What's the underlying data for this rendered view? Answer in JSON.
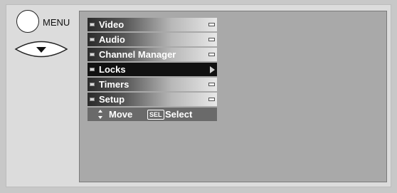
{
  "remote": {
    "menu_label": "MENU",
    "down_key_icon": "down-arrow-icon"
  },
  "osd_menu": {
    "items": [
      {
        "label": "Video",
        "selected": false
      },
      {
        "label": "Audio",
        "selected": false
      },
      {
        "label": "Channel Manager",
        "selected": false
      },
      {
        "label": "Locks",
        "selected": true
      },
      {
        "label": "Timers",
        "selected": false
      },
      {
        "label": "Setup",
        "selected": false
      }
    ],
    "help": {
      "move_icon": "up-down-arrow-icon",
      "move_label": "Move",
      "select_key_label": "SEL",
      "select_label": "Select"
    }
  },
  "colors": {
    "screen_bg": "#a9a9a9",
    "selected_row": "#111111",
    "help_bar": "#6a6a6a"
  }
}
